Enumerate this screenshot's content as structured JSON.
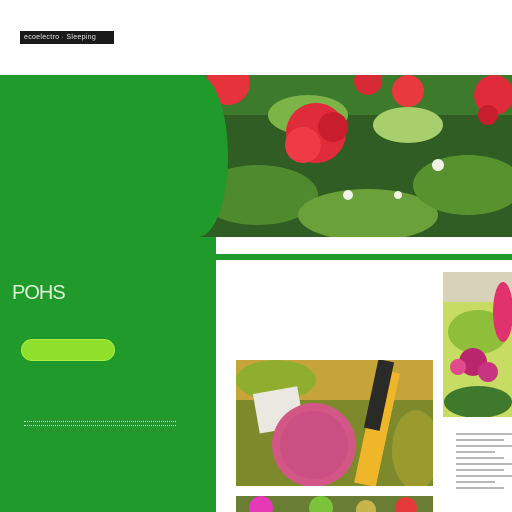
{
  "header": {
    "logo_text": "ecoelectro · Sleeping"
  },
  "hero": {
    "title": "POHS"
  },
  "colors": {
    "brand_green": "#1f9a2b",
    "cta_green": "#8ee02a"
  },
  "images": {
    "hero": "red-flowers-garden-image",
    "side": "pink-flowers-image",
    "main": "gardening-tools-flowers-image",
    "bottom": "colorful-flowers-image"
  }
}
